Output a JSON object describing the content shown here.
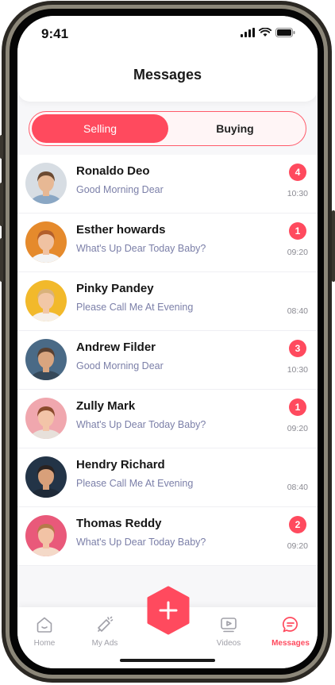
{
  "status_bar": {
    "time": "9:41"
  },
  "header": {
    "title": "Messages"
  },
  "segment": {
    "selling": "Selling",
    "buying": "Buying"
  },
  "messages": [
    {
      "name": "Ronaldo Deo",
      "preview": "Good Morning Dear",
      "time": "10:30",
      "badge": "4",
      "avatar": {
        "bg": "#d7dde3",
        "skin": "#e7b894",
        "hair": "#6b4a32",
        "shirt": "#8aa7c4"
      }
    },
    {
      "name": "Esther howards",
      "preview": "What's Up Dear Today Baby?",
      "time": "09:20",
      "badge": "1",
      "avatar": {
        "bg": "#e58a2c",
        "skin": "#f0c2a2",
        "hair": "#b35f2c",
        "shirt": "#f3f3f3"
      }
    },
    {
      "name": "Pinky Pandey",
      "preview": "Please Call Me At Evening",
      "time": "08:40",
      "badge": "",
      "avatar": {
        "bg": "#f2b92b",
        "skin": "#f2c7a6",
        "hair": "#d9b27a",
        "shirt": "#f6efe8"
      }
    },
    {
      "name": "Andrew Filder",
      "preview": "Good Morning Dear",
      "time": "10:30",
      "badge": "3",
      "avatar": {
        "bg": "#4a6a86",
        "skin": "#d9a57f",
        "hair": "#5a4030",
        "shirt": "#36495a"
      }
    },
    {
      "name": "Zully Mark",
      "preview": "What's Up Dear Today Baby?",
      "time": "09:20",
      "badge": "1",
      "avatar": {
        "bg": "#f0a7ae",
        "skin": "#f3c4a8",
        "hair": "#8a4a2c",
        "shirt": "#e7e0da"
      }
    },
    {
      "name": "Hendry Richard",
      "preview": "Please Call Me At Evening",
      "time": "08:40",
      "badge": "",
      "avatar": {
        "bg": "#233447",
        "skin": "#d8a07a",
        "hair": "#2a2220",
        "shirt": "#1f2a38"
      }
    },
    {
      "name": "Thomas Reddy",
      "preview": "What's Up Dear Today Baby?",
      "time": "09:20",
      "badge": "2",
      "avatar": {
        "bg": "#e9597a",
        "skin": "#f2c3a5",
        "hair": "#b57a4a",
        "shirt": "#f4d9c8"
      }
    }
  ],
  "tabbar": {
    "home": "Home",
    "my_ads": "My Ads",
    "videos": "Videos",
    "messages": "Messages"
  },
  "colors": {
    "accent": "#ff4a5e",
    "muted": "#7b7fa8"
  },
  "icons": {
    "fab": "plus-icon",
    "home": "home-icon",
    "my_ads": "megaphone-icon",
    "videos": "video-icon",
    "messages": "chat-icon"
  }
}
